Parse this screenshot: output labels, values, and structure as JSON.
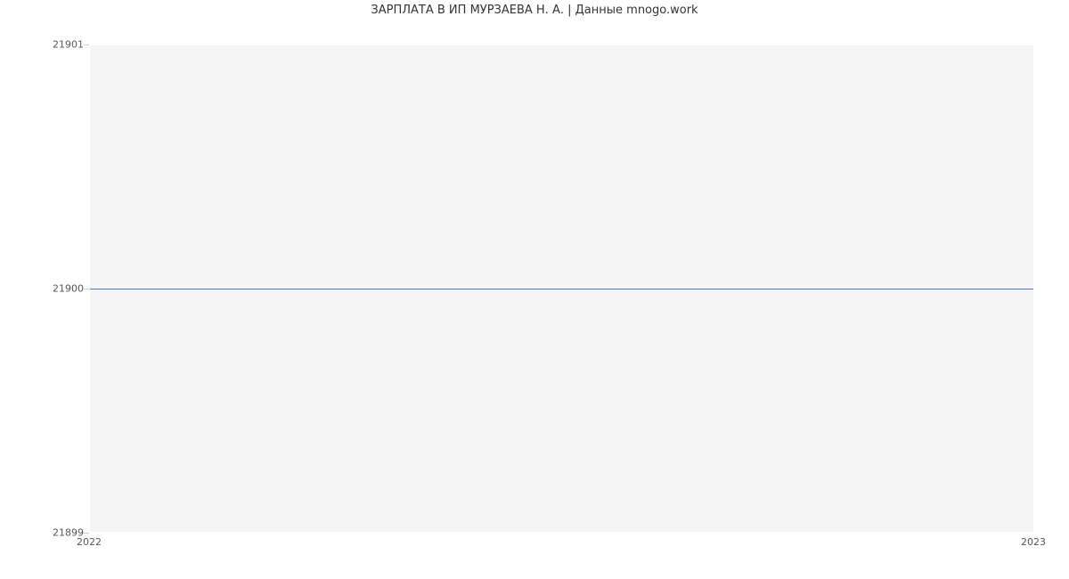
{
  "chart_data": {
    "type": "line",
    "title": "ЗАРПЛАТА В ИП МУРЗАЕВА Н. А. | Данные mnogo.work",
    "x": [
      "2022",
      "2023"
    ],
    "series": [
      {
        "name": "salary",
        "values": [
          21900,
          21900
        ],
        "color": "#4c78d6"
      }
    ],
    "ylim": [
      21899,
      21901
    ],
    "yticks": [
      21899,
      21900,
      21901
    ],
    "xlabel": "",
    "ylabel": ""
  }
}
